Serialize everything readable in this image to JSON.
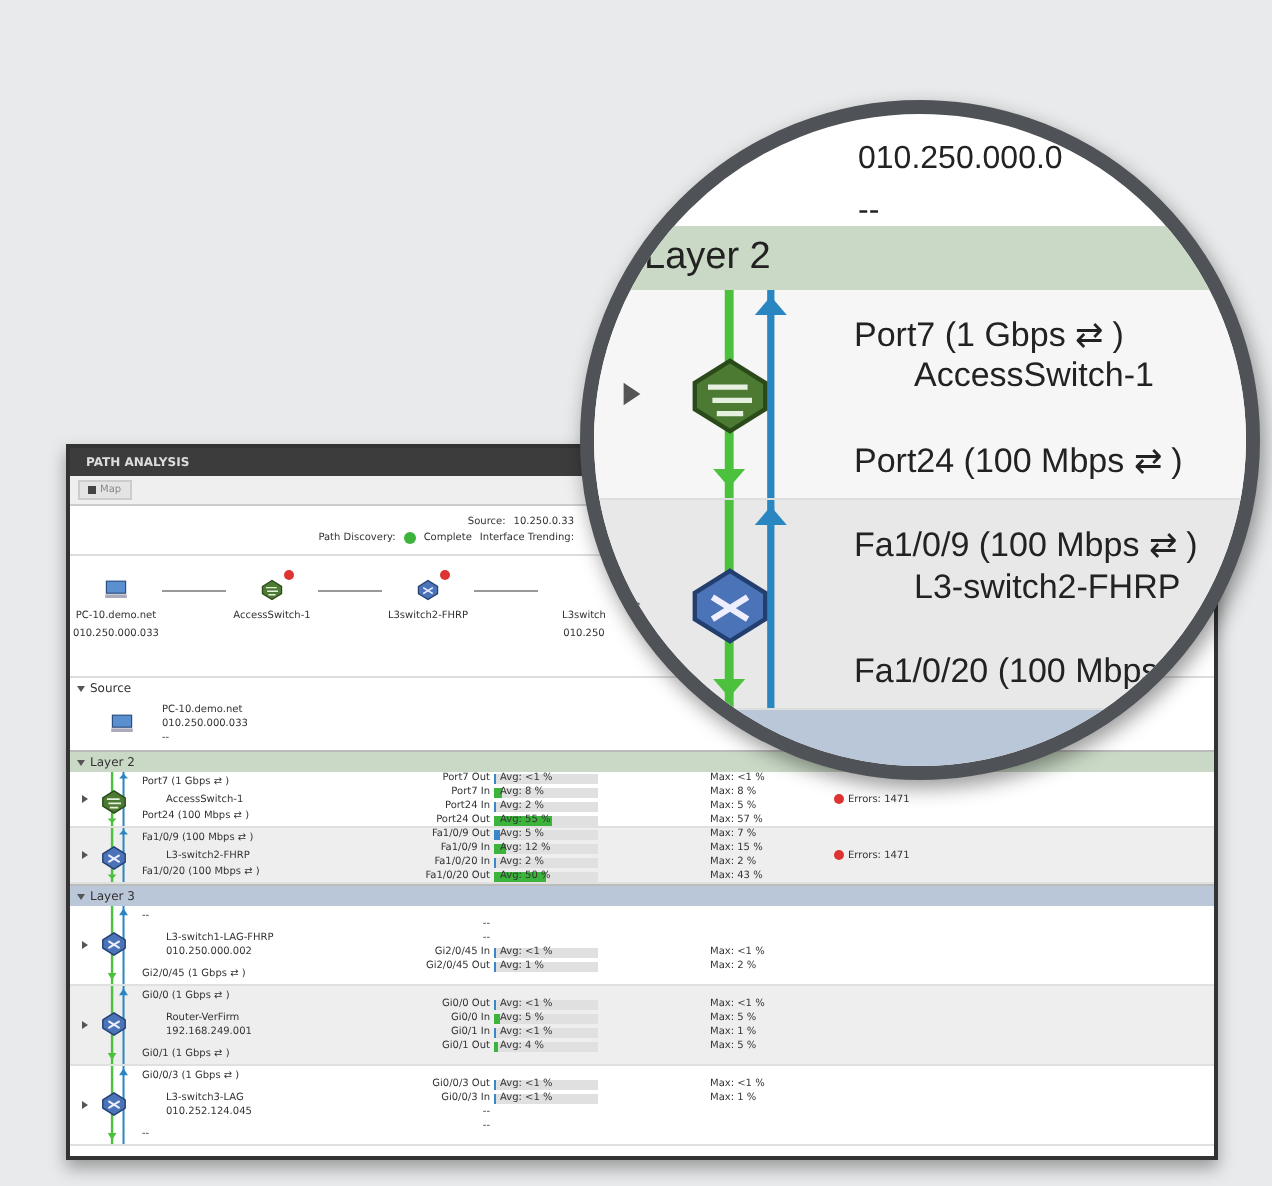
{
  "window": {
    "title": "PATH ANALYSIS"
  },
  "toolbar": [
    {
      "label": "Map"
    }
  ],
  "summary": {
    "source_label": "Source:",
    "source": "10.250.0.33",
    "discovery_label": "Path Discovery:",
    "discovery": "Complete",
    "trending_label": "Interface Trending:"
  },
  "topology": [
    {
      "kind": "pc",
      "name": "PC-10.demo.net",
      "ip": "010.250.000.033",
      "alert": false
    },
    {
      "kind": "switch",
      "name": "AccessSwitch-1",
      "alert": true
    },
    {
      "kind": "router",
      "name": "L3switch2-FHRP",
      "alert": true
    },
    {
      "kind": "none",
      "name": "L3switch",
      "ip": "010.250",
      "alert": false
    }
  ],
  "source_section": {
    "title": "Source",
    "expanded": true,
    "name": "PC-10.demo.net",
    "ip": "010.250.000.033",
    "exit": "--"
  },
  "layers": [
    {
      "title": "Layer 2",
      "color": "#c9d9c6",
      "expanded": true,
      "hops": [
        {
          "expanded": false,
          "kind": "switch",
          "in": "Port7 (1 Gbps ⇄ )",
          "device": "AccessSwitch-1",
          "out": "Port24 (100 Mbps ⇄ )",
          "alert": "Errors: 1471",
          "metrics": [
            {
              "kind": "usage",
              "label": "Port7 Out",
              "avg": "Avg: <1 %",
              "level": 0.02,
              "color": "#3a86c8",
              "max": "Max: <1 %"
            },
            {
              "kind": "usage",
              "label": "Port7 In",
              "avg": "Avg: 8 %",
              "level": 0.08,
              "color": "#3cb43c",
              "max": "Max: 8 %"
            },
            {
              "kind": "usage",
              "label": "Port24 In",
              "avg": "Avg: 2 %",
              "level": 0.02,
              "color": "#3a86c8",
              "max": "Max: 5 %"
            },
            {
              "kind": "usage",
              "label": "Port24 Out",
              "avg": "Avg: 55 %",
              "level": 0.55,
              "color": "#3cb43c",
              "max": "Max: 57 %"
            }
          ]
        },
        {
          "expanded": false,
          "kind": "router",
          "in": "Fa1/0/9 (100 Mbps ⇄ )",
          "device": "L3-switch2-FHRP",
          "out": "Fa1/0/20 (100 Mbps ⇄ )",
          "alert": "Errors: 1471",
          "metrics": [
            {
              "kind": "usage",
              "label": "Fa1/0/9 Out",
              "avg": "Avg: 5 %",
              "level": 0.05,
              "color": "#3a86c8",
              "max": "Max: 7 %"
            },
            {
              "kind": "usage",
              "label": "Fa1/0/9 In",
              "avg": "Avg: 12 %",
              "level": 0.12,
              "color": "#3cb43c",
              "max": "Max: 15 %"
            },
            {
              "kind": "usage",
              "label": "Fa1/0/20 In",
              "avg": "Avg: 2 %",
              "level": 0.02,
              "color": "#3a86c8",
              "max": "Max: 2 %"
            },
            {
              "kind": "usage",
              "label": "Fa1/0/20 Out",
              "avg": "Avg: 50 %",
              "level": 0.5,
              "color": "#3cb43c",
              "max": "Max: 43 %"
            }
          ]
        }
      ]
    },
    {
      "title": "Layer 3",
      "color": "#b9c7d8",
      "expanded": true,
      "hops": [
        {
          "expanded": false,
          "kind": "router",
          "in": "--",
          "device": "L3-switch1-LAG-FHRP",
          "ip": "010.250.000.002",
          "out": "Gi2/0/45 (1 Gbps ⇄ )",
          "metrics": [
            {
              "kind": "none",
              "label": "--"
            },
            {
              "kind": "none",
              "label": "--"
            },
            {
              "kind": "usage",
              "label": "Gi2/0/45 In",
              "avg": "Avg: <1 %",
              "level": 0.01,
              "color": "#3a86c8",
              "max": "Max: <1 %"
            },
            {
              "kind": "usage",
              "label": "Gi2/0/45 Out",
              "avg": "Avg: 1 %",
              "level": 0.01,
              "color": "#3a86c8",
              "max": "Max: 2 %"
            }
          ]
        },
        {
          "expanded": false,
          "kind": "router",
          "in": "Gi0/0 (1 Gbps ⇄ )",
          "device": "Router-VerFirm",
          "ip": "192.168.249.001",
          "out": "Gi0/1 (1 Gbps ⇄ )",
          "metrics": [
            {
              "kind": "usage",
              "label": "Gi0/0 Out",
              "avg": "Avg: <1 %",
              "level": 0.01,
              "color": "#3a86c8",
              "max": "Max: <1 %"
            },
            {
              "kind": "usage",
              "label": "Gi0/0 In",
              "avg": "Avg: 5 %",
              "level": 0.05,
              "color": "#3cb43c",
              "max": "Max: 5 %"
            },
            {
              "kind": "usage",
              "label": "Gi0/1 In",
              "avg": "Avg: <1 %",
              "level": 0.01,
              "color": "#3a86c8",
              "max": "Max: 1 %"
            },
            {
              "kind": "usage",
              "label": "Gi0/1 Out",
              "avg": "Avg: 4 %",
              "level": 0.04,
              "color": "#3cb43c",
              "max": "Max: 5 %"
            }
          ]
        },
        {
          "expanded": false,
          "kind": "router",
          "in": "Gi0/0/3 (1 Gbps ⇄ )",
          "device": "L3-switch3-LAG",
          "ip": "010.252.124.045",
          "out": "--",
          "metrics": [
            {
              "kind": "usage",
              "label": "Gi0/0/3 Out",
              "avg": "Avg: <1 %",
              "level": 0.01,
              "color": "#3a86c8",
              "max": "Max: <1 %"
            },
            {
              "kind": "usage",
              "label": "Gi0/0/3 In",
              "avg": "Avg: <1 %",
              "level": 0.01,
              "color": "#3a86c8",
              "max": "Max: 1 %"
            },
            {
              "kind": "none",
              "label": "--"
            },
            {
              "kind": "none",
              "label": "--"
            }
          ]
        }
      ]
    }
  ],
  "magnifier": {
    "source_ip": "010.250.000.0",
    "source_exit": "--",
    "layer_title": "Layer 2",
    "hops": [
      {
        "expanded": false,
        "kind": "switch",
        "in": "Port7 (1 Gbps ⇄ )",
        "device": "AccessSwitch-1",
        "out": "Port24 (100 Mbps ⇄ )"
      },
      {
        "expanded": false,
        "kind": "router",
        "in": "Fa1/0/9 (100 Mbps ⇄ )",
        "device": "L3-switch2-FHRP",
        "out": "Fa1/0/20 (100 Mbps"
      }
    ]
  }
}
